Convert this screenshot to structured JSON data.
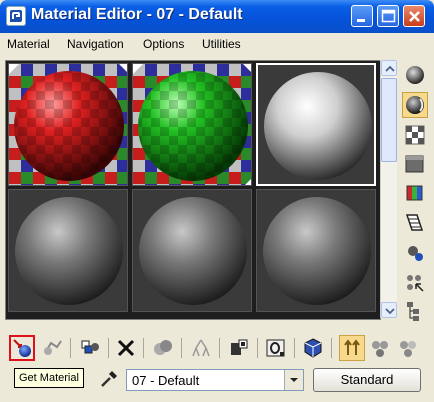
{
  "window": {
    "title": "Material Editor - 07 - Default"
  },
  "title_buttons": [
    "minimize",
    "maximize",
    "close"
  ],
  "menu": {
    "items": [
      "Material",
      "Navigation",
      "Options",
      "Utilities"
    ]
  },
  "slots": [
    {
      "name": "slot-1",
      "sphere": "red checker",
      "active": false
    },
    {
      "name": "slot-2",
      "sphere": "green checker",
      "active": false
    },
    {
      "name": "slot-3",
      "sphere": "white default",
      "active": true
    },
    {
      "name": "slot-4",
      "sphere": "gray default",
      "active": false
    },
    {
      "name": "slot-5",
      "sphere": "gray default",
      "active": false
    },
    {
      "name": "slot-6",
      "sphere": "gray default",
      "active": false
    }
  ],
  "right_toolbar": [
    "sample-type-sphere-icon",
    "backlight-icon",
    "background-checker-icon",
    "sample-uv-tiling-icon",
    "video-color-check-icon",
    "make-preview-icon",
    "options-icon",
    "select-by-material-icon",
    "material-map-navigator-icon"
  ],
  "bottom_toolbar": [
    "get-material-icon",
    "put-to-scene-icon",
    "assign-to-selection-icon",
    "reset-map-icon",
    "make-unique-icon",
    "put-to-library-icon",
    "material-id-channel-icon",
    "show-map-in-viewport-icon",
    "show-end-result-icon",
    "go-to-parent-icon",
    "go-forward-to-sibling-icon"
  ],
  "tooltip": "Get Material",
  "material_name": "07 - Default",
  "material_type_button": "Standard",
  "colors": {
    "titlebar": "#0a5ee6",
    "selected_tool_outline": "#e0101a",
    "active_toggle": "#f6d98a"
  }
}
